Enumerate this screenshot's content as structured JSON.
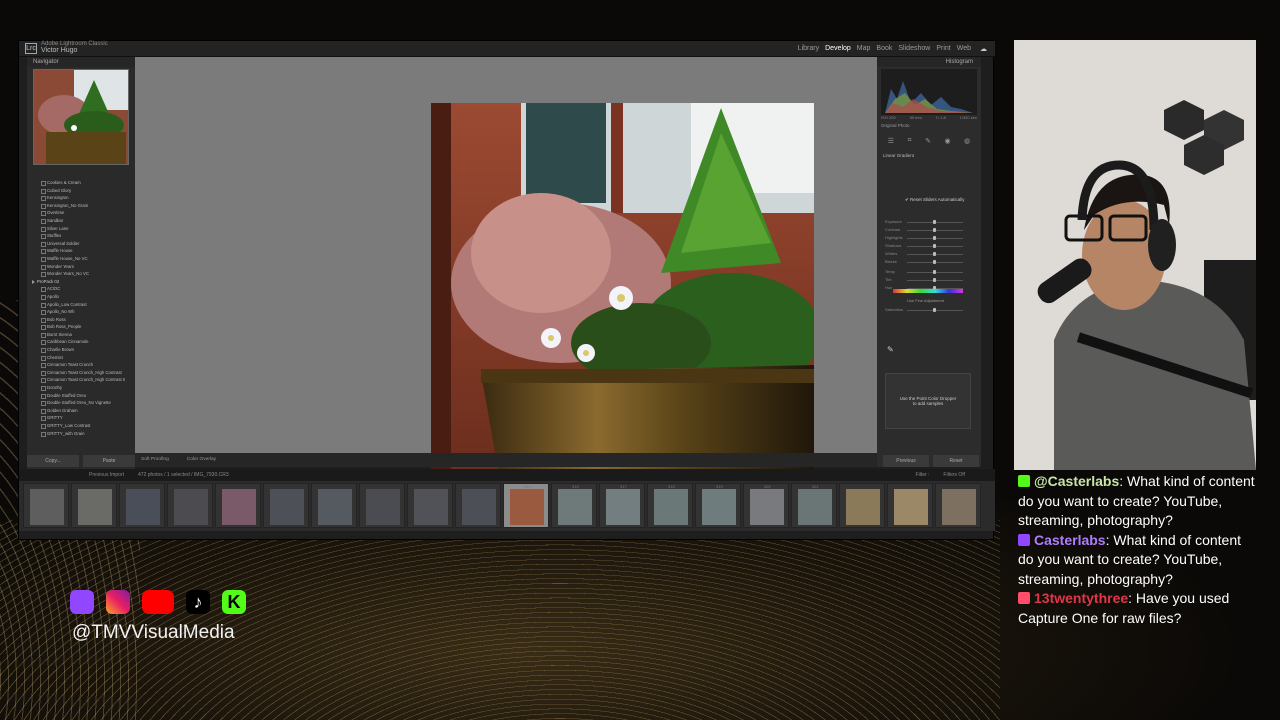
{
  "app": {
    "logo_text": "Lrc",
    "catalog_label": "Adobe Lightroom Classic",
    "user_name": "Victor Hugo",
    "modules": [
      "Library",
      "Develop",
      "Map",
      "Book",
      "Slideshow",
      "Print",
      "Web"
    ],
    "active_module": "Develop"
  },
  "left_panel": {
    "navigator_title": "Navigator",
    "presets": [
      {
        "label": "Cookies & Cream",
        "folder": false
      },
      {
        "label": "Cubed Glory",
        "folder": false
      },
      {
        "label": "Kensington",
        "folder": false
      },
      {
        "label": "Kensington_No Grain",
        "folder": false
      },
      {
        "label": "Overtime",
        "folder": false
      },
      {
        "label": "Sandbar",
        "folder": false
      },
      {
        "label": "Silver Lane",
        "folder": false
      },
      {
        "label": "Stuffles",
        "folder": false
      },
      {
        "label": "Universal Soldier",
        "folder": false
      },
      {
        "label": "Waffle House",
        "folder": false
      },
      {
        "label": "Waffle House_No VC",
        "folder": false
      },
      {
        "label": "Wonder Years",
        "folder": false
      },
      {
        "label": "Wonder Years_No VC",
        "folder": false
      },
      {
        "label": "ProPack 02",
        "folder": true
      },
      {
        "label": "AC/DC",
        "folder": false
      },
      {
        "label": "Apollo",
        "folder": false
      },
      {
        "label": "Apollo_Low Contrast",
        "folder": false
      },
      {
        "label": "Apollo_No Wh",
        "folder": false
      },
      {
        "label": "Bob Ross",
        "folder": false
      },
      {
        "label": "Bob Ross_People",
        "folder": false
      },
      {
        "label": "Burnt Sienna",
        "folder": false
      },
      {
        "label": "Caribbean Cinnamole",
        "folder": false
      },
      {
        "label": "Charlie Brown",
        "folder": false
      },
      {
        "label": "Chemist",
        "folder": false
      },
      {
        "label": "Cinnamon Toast Crunch",
        "folder": false
      },
      {
        "label": "Cinnamon Toast Crunch_High Contrast",
        "folder": false
      },
      {
        "label": "Cinnamon Toast Crunch_High Contrast II",
        "folder": false
      },
      {
        "label": "Dorothy",
        "folder": false
      },
      {
        "label": "Double Stuffed Oreo",
        "folder": false
      },
      {
        "label": "Double Stuffed Oreo_No Vignette",
        "folder": false
      },
      {
        "label": "Golden Graham",
        "folder": false
      },
      {
        "label": "GRITTY",
        "folder": false
      },
      {
        "label": "GRITTY_Low Contrast",
        "folder": false
      },
      {
        "label": "GRITTY_with Grain",
        "folder": false
      }
    ],
    "copy_label": "Copy...",
    "paste_label": "Paste"
  },
  "toolbar": {
    "soft_proofing": "Soft Proofing",
    "mode_label": "Color Overlay"
  },
  "right_panel": {
    "histogram_title": "Histogram",
    "histo_info": [
      "ISO 200",
      "50 mm",
      "f / 1.8",
      "1/320 sec"
    ],
    "original_photo": "Original Photo",
    "section_title": "Linear Gradient",
    "reset_checkbox": "Reset Sliders Automatically",
    "sliders": [
      "Exposure",
      "Contrast",
      "Highlights",
      "Shadows",
      "Whites",
      "Blacks",
      "Temp",
      "Tint",
      "Hue",
      "Saturation"
    ],
    "use_fine_adjust": "Use Fine Adjustment",
    "picker_text_1": "Use the Point Color Dropper",
    "picker_text_2": "to add samples",
    "previous_label": "Previous",
    "reset_label": "Reset"
  },
  "filmstrip": {
    "previous_import": "Previous Import",
    "count_text": "472 photos / 1 selected / IMG_7930.CR3",
    "filter_label": "Filter :",
    "filter_value": "Filters Off",
    "numbers": [
      "",
      "",
      "",
      "",
      "",
      "",
      "",
      "",
      "",
      "",
      "315",
      "316",
      "317",
      "318",
      "319",
      "320",
      "321",
      "",
      "",
      ""
    ],
    "selected_index": 10
  },
  "chat": {
    "messages": [
      {
        "icon": "kick",
        "icon_color": "#53fc18",
        "name": "@Casterlabs",
        "name_color": "#c9e6a8",
        "text": ": What kind of content do you want to create? YouTube, streaming, photography?"
      },
      {
        "icon": "twitch",
        "icon_color": "#9146ff",
        "name": "Casterlabs",
        "name_color": "#b07cff",
        "text": ": What kind of content do you want to create? YouTube, streaming, photography?"
      },
      {
        "icon": "tiktok",
        "icon_color": "#ff4d6a",
        "name": "13twentythree",
        "name_color": "#e0364a",
        "text": ": Have you used Capture One for raw files?"
      }
    ]
  },
  "social": {
    "icons": [
      "twitch-icon",
      "instagram-icon",
      "youtube-icon",
      "tiktok-icon",
      "kick-icon"
    ],
    "handle": "@TMVVisualMedia"
  }
}
